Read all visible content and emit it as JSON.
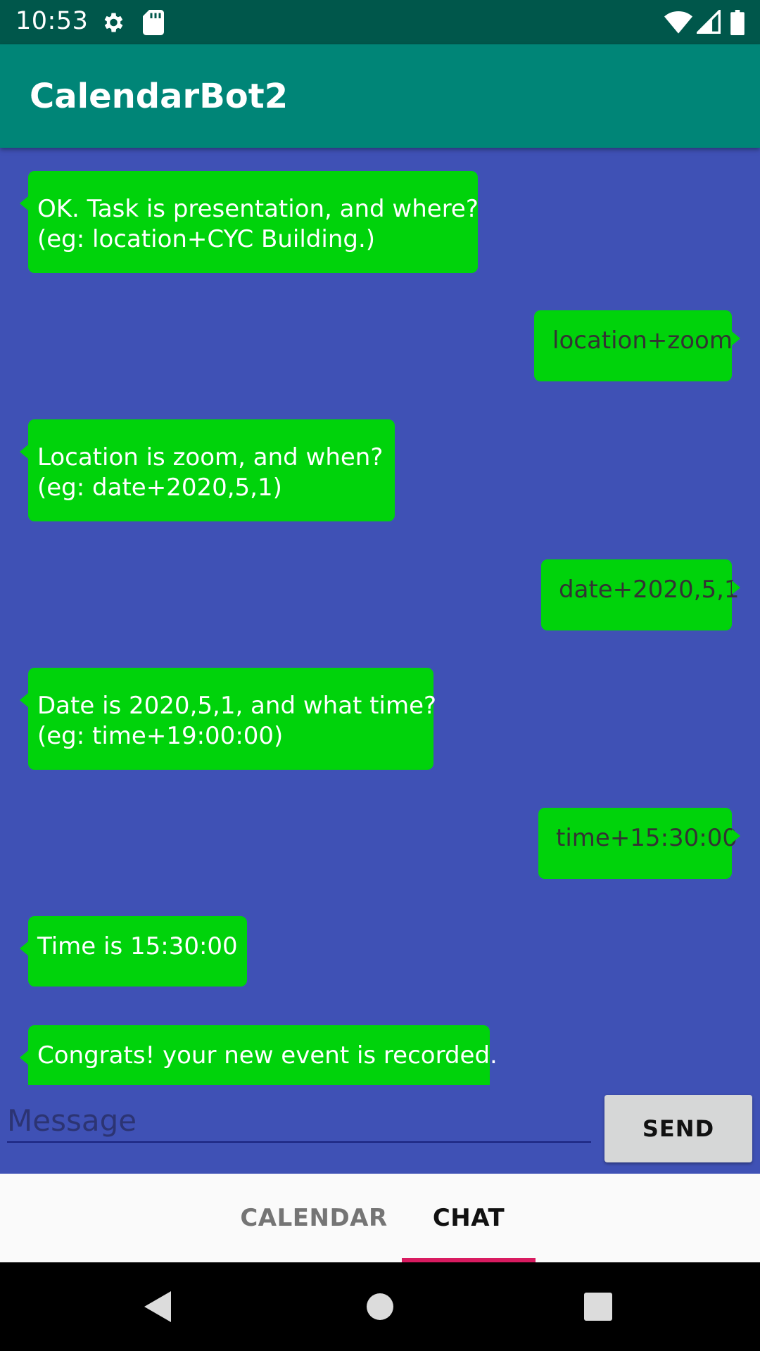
{
  "status_bar": {
    "time": "10:53",
    "icons": [
      "gear-icon",
      "sd-card-icon",
      "wifi-icon",
      "signal-icon",
      "battery-icon"
    ]
  },
  "app_bar": {
    "title": "CalendarBot2"
  },
  "messages": [
    {
      "from": "bot",
      "text": "OK. Task is presentation, and where?\n(eg: location+CYC Building.)"
    },
    {
      "from": "user",
      "text": "location+zoom"
    },
    {
      "from": "bot",
      "text": "Location is zoom, and when?\n(eg: date+2020,5,1)"
    },
    {
      "from": "user",
      "text": "date+2020,5,1"
    },
    {
      "from": "bot",
      "text": "Date is 2020,5,1, and what time?\n(eg: time+19:00:00)"
    },
    {
      "from": "user",
      "text": "time+15:30:00"
    },
    {
      "from": "bot",
      "text": "Time is 15:30:00"
    },
    {
      "from": "bot",
      "text": "Congrats! your new event is recorded."
    }
  ],
  "composer": {
    "placeholder": "Message",
    "value": "",
    "send_label": "SEND"
  },
  "tabs": [
    {
      "label": "CALENDAR",
      "selected": false
    },
    {
      "label": "CHAT",
      "selected": true
    }
  ],
  "nav_bar": {
    "icons": [
      "back-icon",
      "home-icon",
      "recents-icon"
    ]
  },
  "colors": {
    "status_bar": "#00574b",
    "app_bar": "#008577",
    "chat_background": "#3f51b5",
    "bubble": "#00d30b",
    "tab_indicator": "#d81b60"
  }
}
